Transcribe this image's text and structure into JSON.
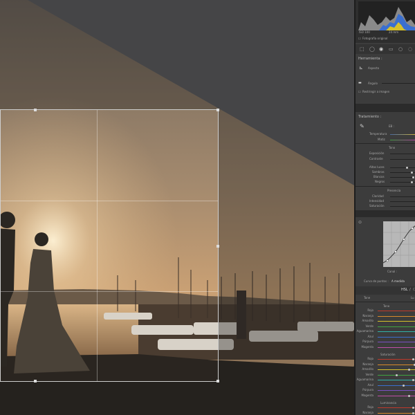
{
  "histogram": {
    "iso": "ISO 100",
    "focal": "24 mm",
    "original_photo_label": "Fotografía original"
  },
  "crop_tools": {
    "title": "Herramienta :",
    "aspect_label": "Aspecto",
    "angle_label": "Ángulo",
    "constrain_label": "Restringir a imagen"
  },
  "basic": {
    "treatment_label": "Tratamiento :",
    "wb_label": "EB :",
    "temperature_label": "Temperatura",
    "tint_label": "Matiz",
    "tone_label": "Tono",
    "exposure_label": "Exposición",
    "contrast_label": "Contraste",
    "highlights_label": "Altas luces",
    "shadows_label": "Sombras",
    "whites_label": "Blancos",
    "blacks_label": "Negros",
    "presence_label": "Presencia",
    "clarity_label": "Claridad",
    "vibrance_label": "Intensidad",
    "saturation_label": "Saturación"
  },
  "curve": {
    "channel_label": "Canal :",
    "point_curve_label": "Curva de puntos :",
    "point_curve_value": "A medida"
  },
  "hsl": {
    "tab_hsl": "HSL",
    "tab_sep": "/",
    "tab_color": "Color",
    "sub_tone": "Tone",
    "sub_lu": "Lu",
    "hue_section": "Tono",
    "saturation_section": "Saturación",
    "luminance_section": "Luminancia",
    "colors": [
      "Rojo",
      "Naranja",
      "Amarillo",
      "Verde",
      "Aguamarina",
      "Azul",
      "Púrpura",
      "Magenta"
    ],
    "lum_colors": [
      "Rojo",
      "Naranja"
    ],
    "color_hex": [
      "#c0392b",
      "#d98a2b",
      "#d6c12b",
      "#3fa53f",
      "#2fb3a8",
      "#3a6fd0",
      "#7b4fc4",
      "#c04fa8"
    ]
  }
}
